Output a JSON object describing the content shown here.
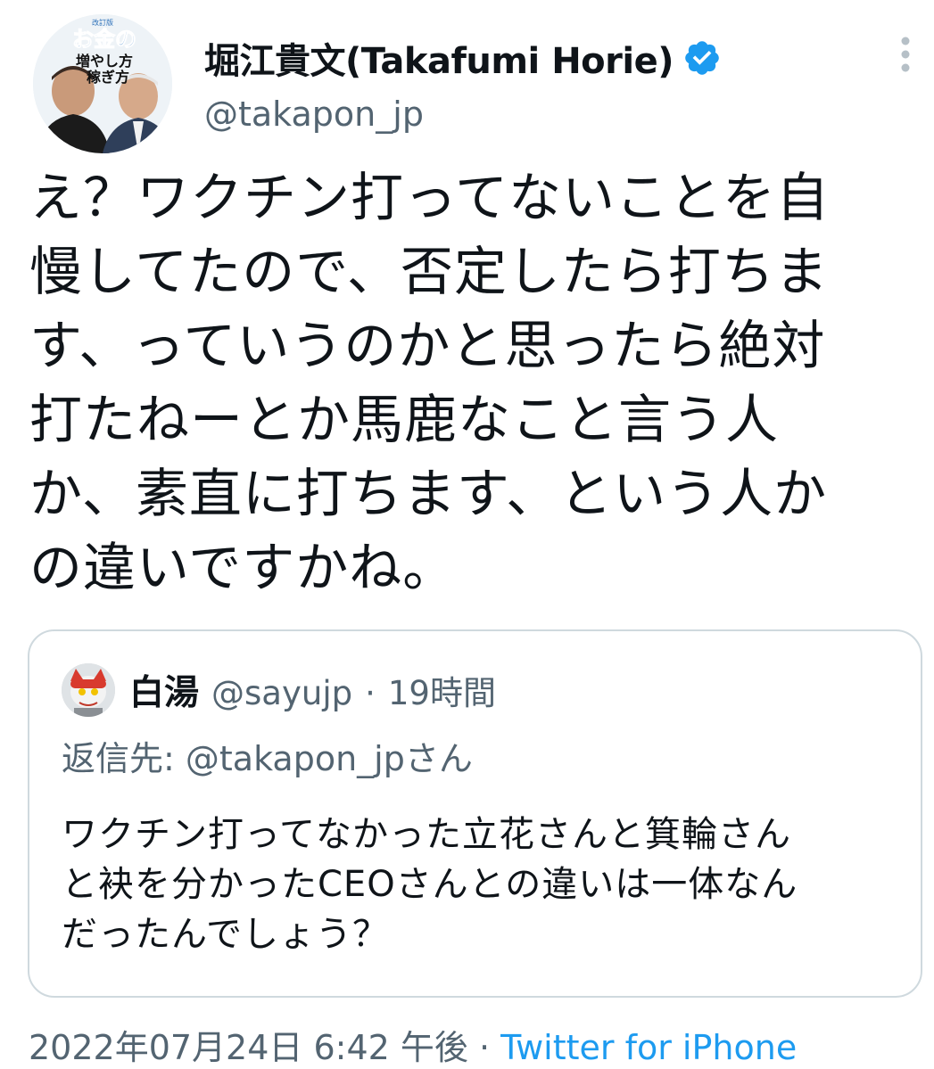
{
  "author": {
    "display_name": "堀江貴文(Takafumi Horie)",
    "handle": "@takapon_jp",
    "avatar_icon": "profile-avatar",
    "avatar_book_text": {
      "small": "改訂版",
      "line1": "お金の",
      "line2": "増やし方",
      "line3": "稼ぎ方"
    },
    "verified_icon": "verified-badge-icon"
  },
  "tweet": {
    "text": "え？ワクチン打ってないことを自\n慢してたので、否定したら打ちま\nす、っていうのかと思ったら絶対\n打たねーとか馬鹿なこと言う人\nか、素直に打ちます、という人か\nの違いですかね。"
  },
  "quoted_tweet": {
    "display_name": "白湯",
    "handle": "@sayujp",
    "separator": "·",
    "time": "19時間",
    "reply_prefix": "返信先: ",
    "reply_to": "@takapon_jp",
    "reply_suffix": "さん",
    "text": "ワクチン打ってなかった立花さんと箕輪さん\nと袂を分かったCEOさんとの違いは一体なん\nだったんでしょう？"
  },
  "footer": {
    "timestamp": "2022年07月24日 6:42 午後",
    "separator": " · ",
    "source": "Twitter for iPhone"
  },
  "colors": {
    "text_primary": "#0f1419",
    "text_secondary": "#536471",
    "accent": "#1d9bf0",
    "border": "#cfd9de"
  }
}
